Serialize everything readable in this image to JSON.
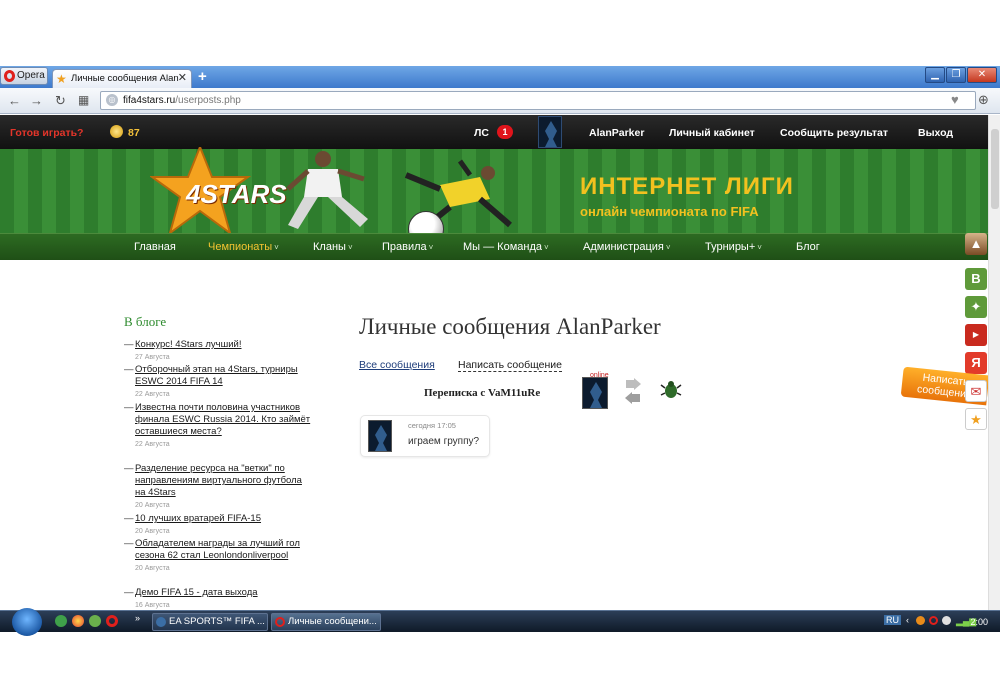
{
  "browser": {
    "menu_button": "Opera",
    "tab_title": "Личные сообщения Alan",
    "url_domain": "fifa4stars.ru",
    "url_path": "/userposts.php"
  },
  "site": {
    "ready_label": "Готов играть?",
    "coins": "87",
    "ls_label": "ЛС",
    "ls_count": "1",
    "username": "AlanParker",
    "cabinet": "Личный кабинет",
    "report": "Сообщить результат",
    "logout": "Выход",
    "logo_text": "4STARS",
    "banner_title": "ИНТЕРНЕТ ЛИГИ",
    "banner_subtitle": "онлайн чемпионата по FIFA"
  },
  "menu": [
    {
      "label": "Главная",
      "chev": ""
    },
    {
      "label": "Чемпионаты",
      "chev": "˅"
    },
    {
      "label": "Кланы",
      "chev": "˅"
    },
    {
      "label": "Правила",
      "chev": "˅"
    },
    {
      "label": "Мы — Команда",
      "chev": "˅"
    },
    {
      "label": "Администрация",
      "chev": "˅"
    },
    {
      "label": "Турниры+",
      "chev": "˅"
    },
    {
      "label": "Блог",
      "chev": ""
    }
  ],
  "sidebar": {
    "title": "В блоге",
    "items": [
      {
        "text": "Конкурс! 4Stars лучший!",
        "date": "27 Августа"
      },
      {
        "text": "Отборочный этап на 4Stars, турниры ESWC 2014 FIFA 14",
        "date": "22 Августа"
      },
      {
        "text": "Известна почти половина участников финала ESWC Russia 2014. Кто займёт оставшиеся места?",
        "date": "22 Августа"
      },
      {
        "text": "Разделение ресурса на \"ветки\" по направлениям виртуального футбола на 4Stars",
        "date": "20 Августа"
      },
      {
        "text": "10 лучших вратарей FIFA-15",
        "date": "20 Августа"
      },
      {
        "text": "Обладателем награды за лучший гол сезона 62 стал Leonlondonliverpool",
        "date": "20 Августа"
      },
      {
        "text": "Демо FIFA 15 - дата выхода",
        "date": "16 Августа"
      }
    ]
  },
  "main": {
    "title": "Личные сообщения AlanParker",
    "all_messages": "Все сообщения",
    "write_message": "Написать сообщение",
    "conversation_title": "Переписка с VaM11uRe",
    "online_label": "online",
    "message": {
      "time": "сегодня 17:05",
      "text": "играем группу?"
    }
  },
  "feedback_tab": "Написать сообщение",
  "social": [
    "В",
    "Я"
  ],
  "taskbar": {
    "items": [
      "EA SPORTS™ FIFA ...",
      "Личные сообщени..."
    ],
    "lang": "RU",
    "clock": "2:00"
  },
  "colors": {
    "accent_green": "#2e8b2e",
    "accent_yellow": "#f3c11f",
    "badge_red": "#e0141b",
    "tab_blue": "#3d79cc"
  }
}
